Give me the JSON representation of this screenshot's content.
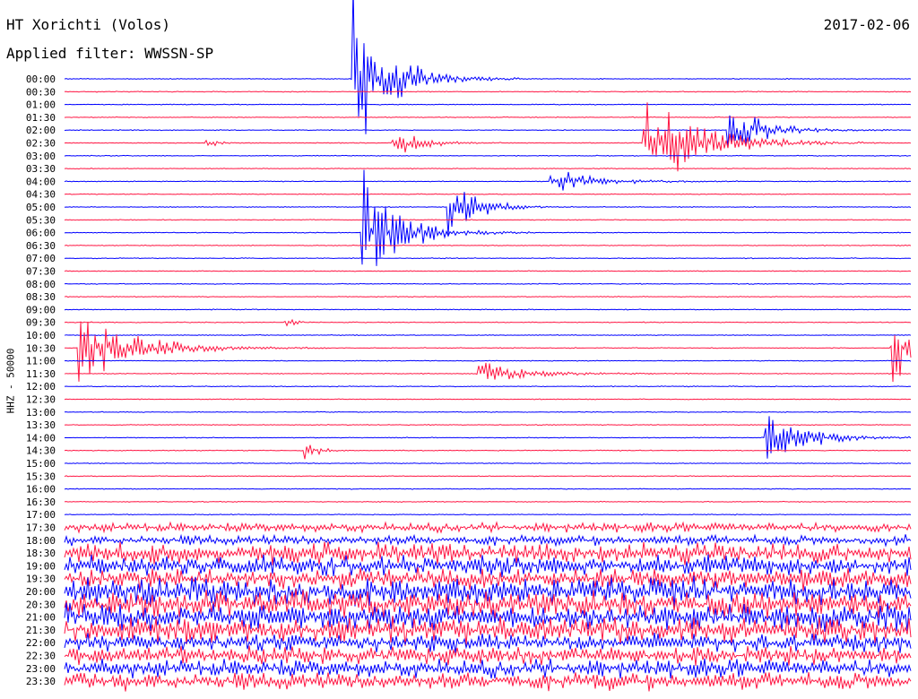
{
  "header": {
    "station": "HT Xorichti (Volos)",
    "filter": "Applied filter: WWSSN-SP",
    "date": "2017-02-06"
  },
  "colors": {
    "trace_a": "#0000ff",
    "trace_b": "#ff1744",
    "background": "#ffffff"
  },
  "chart_data": {
    "type": "line",
    "title": "HT Xorichti (Volos)",
    "subtitle": "Applied filter: WWSSN-SP",
    "date": "2017-02-06",
    "ylabel": "HHZ - 50000",
    "xlabel": "",
    "grid": false,
    "legend": "none",
    "trace_minutes": 30,
    "row_labels": [
      "00:00",
      "00:30",
      "01:00",
      "01:30",
      "02:00",
      "02:30",
      "03:00",
      "03:30",
      "04:00",
      "04:30",
      "05:00",
      "05:30",
      "06:00",
      "06:30",
      "07:00",
      "07:30",
      "08:00",
      "08:30",
      "09:00",
      "09:30",
      "10:00",
      "10:30",
      "11:00",
      "11:30",
      "12:00",
      "12:30",
      "13:00",
      "13:30",
      "14:00",
      "14:30",
      "15:00",
      "15:30",
      "16:00",
      "16:30",
      "17:00",
      "17:30",
      "18:00",
      "18:30",
      "19:00",
      "19:30",
      "20:00",
      "20:30",
      "21:00",
      "21:30",
      "22:00",
      "22:30",
      "23:00",
      "23:30"
    ],
    "row_colors": [
      "blue",
      "red"
    ],
    "events": [
      {
        "row": "00:00",
        "minute": 10.2,
        "amplitude": 8,
        "duration_min": 2
      },
      {
        "row": "02:00",
        "minute": 23.5,
        "amplitude": 2.5,
        "duration_min": 2
      },
      {
        "row": "02:30",
        "minute": 5.0,
        "amplitude": 0.8,
        "duration_min": 0.5
      },
      {
        "row": "02:30",
        "minute": 11.6,
        "amplitude": 1.5,
        "duration_min": 1.5
      },
      {
        "row": "02:30",
        "minute": 20.5,
        "amplitude": 5,
        "duration_min": 3
      },
      {
        "row": "04:00",
        "minute": 17.2,
        "amplitude": 1.2,
        "duration_min": 2.5
      },
      {
        "row": "05:00",
        "minute": 13.6,
        "amplitude": 3,
        "duration_min": 1.5
      },
      {
        "row": "06:00",
        "minute": 10.5,
        "amplitude": 6,
        "duration_min": 2
      },
      {
        "row": "09:30",
        "minute": 7.8,
        "amplitude": 0.8,
        "duration_min": 0.5
      },
      {
        "row": "10:30",
        "minute": 0.5,
        "amplitude": 3.5,
        "duration_min": 3
      },
      {
        "row": "11:30",
        "minute": 14.6,
        "amplitude": 1.2,
        "duration_min": 2.5
      },
      {
        "row": "14:00",
        "minute": 24.8,
        "amplitude": 3,
        "duration_min": 2
      },
      {
        "row": "14:30",
        "minute": 8.5,
        "amplitude": 1.2,
        "duration_min": 0.6
      },
      {
        "row": "10:30",
        "minute": 29.3,
        "amplitude": 4,
        "duration_min": 1.5
      }
    ],
    "noise_onset": "17:30"
  }
}
